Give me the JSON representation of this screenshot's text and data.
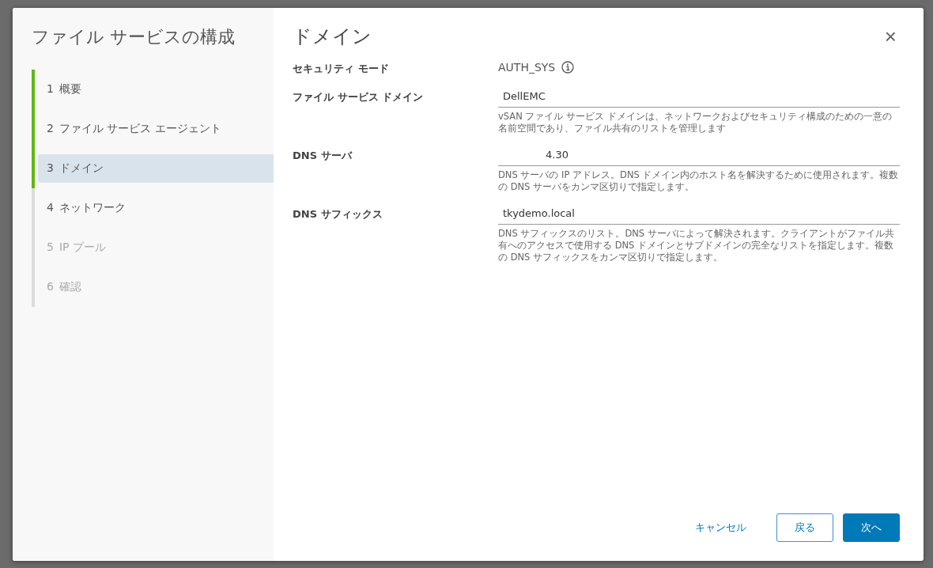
{
  "wizard": {
    "title": "ファイル サービスの構成",
    "steps": [
      {
        "number": "1",
        "label": "概要",
        "completed": true,
        "selected": false,
        "disabled": false
      },
      {
        "number": "2",
        "label": "ファイル サービス エージェント",
        "completed": true,
        "selected": false,
        "disabled": false
      },
      {
        "number": "3",
        "label": "ドメイン",
        "completed": true,
        "selected": true,
        "disabled": false
      },
      {
        "number": "4",
        "label": "ネットワーク",
        "completed": false,
        "selected": false,
        "disabled": false
      },
      {
        "number": "5",
        "label": "IP プール",
        "completed": false,
        "selected": false,
        "disabled": true
      },
      {
        "number": "6",
        "label": "確認",
        "completed": false,
        "selected": false,
        "disabled": true
      }
    ]
  },
  "page": {
    "title": "ドメイン",
    "close": "×",
    "fields": [
      {
        "kind": "static",
        "label": "セキュリティ モード",
        "value": "AUTH_SYS",
        "info": true
      },
      {
        "kind": "input",
        "label": "ファイル サービス ドメイン",
        "value": "DellEMC",
        "help": "vSAN ファイル サービス ドメインは、ネットワークおよびセキュリティ構成のための一意の名前空間であり、ファイル共有のリストを管理します"
      },
      {
        "kind": "input",
        "label": "DNS サーバ",
        "value": "4.30",
        "scrolled": true,
        "help": "DNS サーバの IP アドレス。DNS ドメイン内のホスト名を解決するために使用されます。複数の DNS サーバをカンマ区切りで指定します。"
      },
      {
        "kind": "input",
        "label": "DNS サフィックス",
        "value": "tkydemo.local",
        "help": "DNS サフィックスのリスト。DNS サーバによって解決されます。クライアントがファイル共有へのアクセスで使用する DNS ドメインとサブドメインの完全なリストを指定します。複数の DNS サフィックスをカンマ区切りで指定します。"
      }
    ]
  },
  "buttons": [
    {
      "kind": "link",
      "label": "キャンセル"
    },
    {
      "kind": "outline",
      "label": "戻る"
    },
    {
      "kind": "primary",
      "label": "次へ"
    }
  ]
}
